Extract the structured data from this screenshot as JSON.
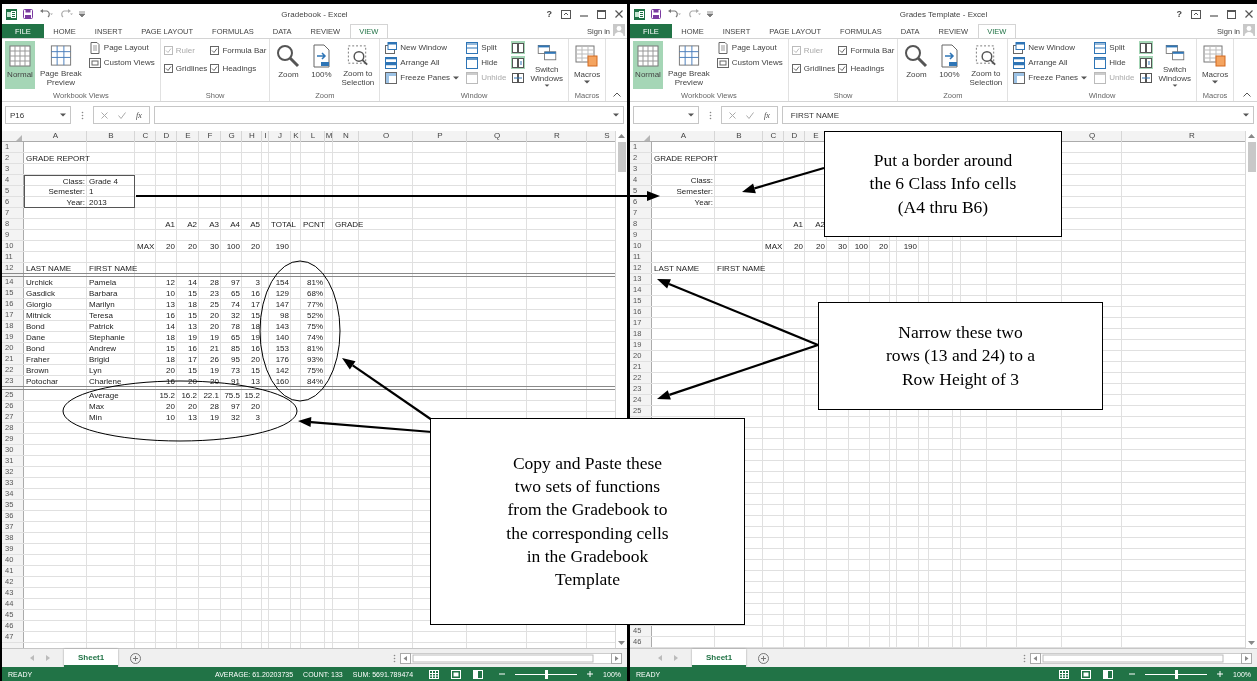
{
  "windows": [
    {
      "title": "Gradebook - Excel",
      "help": "?",
      "sign_in": "Sign in",
      "tabs": [
        {
          "label": "FILE",
          "kind": "file",
          "selected": false
        },
        {
          "label": "HOME",
          "kind": "tab",
          "selected": false
        },
        {
          "label": "INSERT",
          "kind": "tab",
          "selected": false
        },
        {
          "label": "PAGE LAYOUT",
          "kind": "tab",
          "selected": false
        },
        {
          "label": "FORMULAS",
          "kind": "tab",
          "selected": false
        },
        {
          "label": "DATA",
          "kind": "tab",
          "selected": false
        },
        {
          "label": "REVIEW",
          "kind": "tab",
          "selected": false
        },
        {
          "label": "VIEW",
          "kind": "tab",
          "selected": true
        }
      ],
      "ribbon": [
        {
          "label": "Workbook Views",
          "columns": [
            [
              {
                "kind": "large",
                "label": "Normal",
                "selected": true,
                "dropdown": false
              }
            ],
            [
              {
                "kind": "large",
                "label": "Page Break\nPreview",
                "selected": false,
                "dropdown": false
              }
            ],
            [
              {
                "kind": "small",
                "label": "Page Layout",
                "disabled": false,
                "dropdown": false
              },
              {
                "kind": "small",
                "label": "Custom Views",
                "disabled": false,
                "dropdown": false
              }
            ]
          ]
        },
        {
          "label": "Show",
          "columns": [
            [
              {
                "kind": "check",
                "label": "Ruler",
                "checked": true,
                "disabled": true
              },
              {
                "kind": "check",
                "label": "Gridlines",
                "checked": true,
                "disabled": false
              }
            ],
            [
              {
                "kind": "check",
                "label": "Formula Bar",
                "checked": true,
                "disabled": false
              },
              {
                "kind": "check",
                "label": "Headings",
                "checked": true,
                "disabled": false
              }
            ]
          ]
        },
        {
          "label": "Zoom",
          "columns": [
            [
              {
                "kind": "large",
                "label": "Zoom",
                "selected": false,
                "dropdown": false
              }
            ],
            [
              {
                "kind": "large",
                "label": "100%",
                "selected": false,
                "dropdown": false
              }
            ],
            [
              {
                "kind": "large",
                "label": "Zoom to\nSelection",
                "selected": false,
                "dropdown": false
              }
            ]
          ]
        },
        {
          "label": "Window",
          "columns": [
            [
              {
                "kind": "small",
                "label": "New Window",
                "disabled": false,
                "dropdown": false
              },
              {
                "kind": "small",
                "label": "Arrange All",
                "disabled": false,
                "dropdown": false
              },
              {
                "kind": "small",
                "label": "Freeze Panes",
                "disabled": false,
                "dropdown": true
              }
            ],
            [
              {
                "kind": "small",
                "label": "Split",
                "disabled": false,
                "dropdown": false
              },
              {
                "kind": "small",
                "label": "Hide",
                "disabled": false,
                "dropdown": false
              },
              {
                "kind": "small",
                "label": "Unhide",
                "disabled": true,
                "dropdown": false
              }
            ],
            [
              {
                "kind": "icon",
                "selected": true
              },
              {
                "kind": "icon",
                "selected": true
              },
              {
                "kind": "icon",
                "selected": false
              }
            ],
            [
              {
                "kind": "large",
                "label": "Switch\nWindows",
                "selected": false,
                "dropdown": true
              }
            ]
          ]
        },
        {
          "label": "Macros",
          "columns": [
            [
              {
                "kind": "large",
                "label": "Macros",
                "selected": false,
                "dropdown": true
              }
            ]
          ]
        }
      ],
      "name_box": "P16",
      "function_label": "fx",
      "columns": [
        {
          "label": "A"
        },
        {
          "label": "B"
        },
        {
          "label": "C"
        },
        {
          "label": "D"
        },
        {
          "label": "E"
        },
        {
          "label": "F"
        },
        {
          "label": "G"
        },
        {
          "label": "H"
        },
        {
          "label": "I"
        },
        {
          "label": "J"
        },
        {
          "label": "K"
        },
        {
          "label": "L"
        },
        {
          "label": "M"
        },
        {
          "label": "N"
        },
        {
          "label": "O"
        },
        {
          "label": "P"
        },
        {
          "label": "Q"
        },
        {
          "label": "R"
        },
        {
          "label": "S"
        }
      ],
      "rows": [
        {
          "kind": "blank",
          "num": "1"
        },
        {
          "kind": "title",
          "num": "2",
          "cells": [
            "GRADE REPORT"
          ]
        },
        {
          "kind": "blank",
          "num": "3"
        },
        {
          "kind": "info",
          "num": "4",
          "bordered": true,
          "cells": [
            "Class:",
            "Grade 4"
          ]
        },
        {
          "kind": "info",
          "num": "5",
          "bordered": true,
          "cells": [
            "Semester:",
            "1"
          ]
        },
        {
          "kind": "info",
          "num": "6",
          "bordered": true,
          "cells": [
            "Year:",
            "2013"
          ]
        },
        {
          "kind": "blank",
          "num": "7"
        },
        {
          "kind": "head",
          "num": "8",
          "cells": [
            null,
            null,
            null,
            "A1",
            "A2",
            "A3",
            "A4",
            "A5",
            null,
            "TOTAL",
            null,
            "PCNT",
            null,
            "GRADE"
          ]
        },
        {
          "kind": "blank",
          "num": "9"
        },
        {
          "kind": "data",
          "num": "10",
          "cells": [
            null,
            null,
            "MAX",
            "20",
            "20",
            "30",
            "100",
            "20",
            null,
            "190"
          ]
        },
        {
          "kind": "blank",
          "num": "11"
        },
        {
          "kind": "head",
          "num": "12",
          "cells": [
            "LAST NAME",
            "FIRST NAME"
          ]
        },
        {
          "kind": "thin"
        },
        {
          "kind": "data",
          "num": "14",
          "cells": [
            "Urchick",
            "Pamela",
            null,
            "12",
            "14",
            "28",
            "97",
            "3",
            null,
            "154",
            null,
            "81%"
          ]
        },
        {
          "kind": "data",
          "num": "15",
          "cells": [
            "Gasdick",
            "Barbara",
            null,
            "10",
            "15",
            "23",
            "65",
            "16",
            null,
            "129",
            null,
            "68%"
          ]
        },
        {
          "kind": "data",
          "num": "16",
          "cells": [
            "Giorgio",
            "Marilyn",
            null,
            "13",
            "18",
            "25",
            "74",
            "17",
            null,
            "147",
            null,
            "77%"
          ]
        },
        {
          "kind": "data",
          "num": "17",
          "cells": [
            "Mitnick",
            "Teresa",
            null,
            "16",
            "15",
            "20",
            "32",
            "15",
            null,
            "98",
            null,
            "52%"
          ]
        },
        {
          "kind": "data",
          "num": "18",
          "cells": [
            "Bond",
            "Patrick",
            null,
            "14",
            "13",
            "20",
            "78",
            "18",
            null,
            "143",
            null,
            "75%"
          ]
        },
        {
          "kind": "data",
          "num": "19",
          "cells": [
            "Dane",
            "Stephanie",
            null,
            "18",
            "19",
            "19",
            "65",
            "19",
            null,
            "140",
            null,
            "74%"
          ]
        },
        {
          "kind": "data",
          "num": "20",
          "cells": [
            "Bond",
            "Andrew",
            null,
            "15",
            "16",
            "21",
            "85",
            "16",
            null,
            "153",
            null,
            "81%"
          ]
        },
        {
          "kind": "data",
          "num": "21",
          "cells": [
            "Fraher",
            "Brigid",
            null,
            "18",
            "17",
            "26",
            "95",
            "20",
            null,
            "176",
            null,
            "93%"
          ]
        },
        {
          "kind": "data",
          "num": "22",
          "cells": [
            "Brown",
            "Lyn",
            null,
            "20",
            "15",
            "19",
            "73",
            "15",
            null,
            "142",
            null,
            "75%"
          ]
        },
        {
          "kind": "data",
          "num": "23",
          "cells": [
            "Potochar",
            "Charlene",
            null,
            "16",
            "20",
            "20",
            "91",
            "13",
            null,
            "160",
            null,
            "84%"
          ]
        },
        {
          "kind": "thin"
        },
        {
          "kind": "data",
          "num": "25",
          "cells": [
            null,
            "Average",
            null,
            "15.2",
            "16.2",
            "22.1",
            "75.5",
            "15.2"
          ]
        },
        {
          "kind": "data",
          "num": "26",
          "cells": [
            null,
            "Max",
            null,
            "20",
            "20",
            "28",
            "97",
            "20"
          ]
        },
        {
          "kind": "data",
          "num": "27",
          "cells": [
            null,
            "Min",
            null,
            "10",
            "13",
            "19",
            "32",
            "3"
          ]
        },
        {
          "kind": "blank",
          "num": "28"
        },
        {
          "kind": "blank",
          "num": "29"
        },
        {
          "kind": "blank",
          "num": "30"
        },
        {
          "kind": "blank",
          "num": "31"
        },
        {
          "kind": "blank",
          "num": "32"
        },
        {
          "kind": "blank",
          "num": "33"
        },
        {
          "kind": "blank",
          "num": "34"
        },
        {
          "kind": "blank",
          "num": "35"
        },
        {
          "kind": "blank",
          "num": "36"
        },
        {
          "kind": "blank",
          "num": "37"
        },
        {
          "kind": "blank",
          "num": "38"
        },
        {
          "kind": "blank",
          "num": "39"
        },
        {
          "kind": "blank",
          "num": "40"
        },
        {
          "kind": "blank",
          "num": "41"
        },
        {
          "kind": "blank",
          "num": "42"
        },
        {
          "kind": "blank",
          "num": "43"
        },
        {
          "kind": "blank",
          "num": "44"
        },
        {
          "kind": "blank",
          "num": "45"
        },
        {
          "kind": "blank",
          "num": "46"
        },
        {
          "kind": "blank",
          "num": "47"
        },
        {
          "kind": "blank"
        }
      ],
      "sheets": [
        {
          "label": "Sheet1",
          "selected": true
        }
      ],
      "status": {
        "mode": "READY",
        "summary": [
          "AVERAGE: 61.20203735",
          "COUNT: 133",
          "SUM: 5691.789474"
        ],
        "zoom_slider": {
          "level": 0.5
        },
        "zoom": "100%"
      }
    },
    {
      "title": "Grades Template - Excel",
      "help": "?",
      "sign_in": "Sign in",
      "tabs": [
        {
          "label": "FILE",
          "kind": "file",
          "selected": false
        },
        {
          "label": "HOME",
          "kind": "tab",
          "selected": false
        },
        {
          "label": "INSERT",
          "kind": "tab",
          "selected": false
        },
        {
          "label": "PAGE LAYOUT",
          "kind": "tab",
          "selected": false
        },
        {
          "label": "FORMULAS",
          "kind": "tab",
          "selected": false
        },
        {
          "label": "DATA",
          "kind": "tab",
          "selected": false
        },
        {
          "label": "REVIEW",
          "kind": "tab",
          "selected": false
        },
        {
          "label": "VIEW",
          "kind": "tab",
          "selected": true
        }
      ],
      "ribbon": [
        {
          "label": "Workbook Views",
          "columns": [
            [
              {
                "kind": "large",
                "label": "Normal",
                "selected": true,
                "dropdown": false
              }
            ],
            [
              {
                "kind": "large",
                "label": "Page Break\nPreview",
                "selected": false,
                "dropdown": false
              }
            ],
            [
              {
                "kind": "small",
                "label": "Page Layout",
                "disabled": false,
                "dropdown": false
              },
              {
                "kind": "small",
                "label": "Custom Views",
                "disabled": false,
                "dropdown": false
              }
            ]
          ]
        },
        {
          "label": "Show",
          "columns": [
            [
              {
                "kind": "check",
                "label": "Ruler",
                "checked": true,
                "disabled": true
              },
              {
                "kind": "check",
                "label": "Gridlines",
                "checked": true,
                "disabled": false
              }
            ],
            [
              {
                "kind": "check",
                "label": "Formula Bar",
                "checked": true,
                "disabled": false
              },
              {
                "kind": "check",
                "label": "Headings",
                "checked": true,
                "disabled": false
              }
            ]
          ]
        },
        {
          "label": "Zoom",
          "columns": [
            [
              {
                "kind": "large",
                "label": "Zoom",
                "selected": false,
                "dropdown": false
              }
            ],
            [
              {
                "kind": "large",
                "label": "100%",
                "selected": false,
                "dropdown": false
              }
            ],
            [
              {
                "kind": "large",
                "label": "Zoom to\nSelection",
                "selected": false,
                "dropdown": false
              }
            ]
          ]
        },
        {
          "label": "Window",
          "columns": [
            [
              {
                "kind": "small",
                "label": "New Window",
                "disabled": false,
                "dropdown": false
              },
              {
                "kind": "small",
                "label": "Arrange All",
                "disabled": false,
                "dropdown": false
              },
              {
                "kind": "small",
                "label": "Freeze Panes",
                "disabled": false,
                "dropdown": true
              }
            ],
            [
              {
                "kind": "small",
                "label": "Split",
                "disabled": false,
                "dropdown": false
              },
              {
                "kind": "small",
                "label": "Hide",
                "disabled": false,
                "dropdown": false
              },
              {
                "kind": "small",
                "label": "Unhide",
                "disabled": true,
                "dropdown": false
              }
            ],
            [
              {
                "kind": "icon",
                "selected": true
              },
              {
                "kind": "icon",
                "selected": true
              },
              {
                "kind": "icon",
                "selected": false
              }
            ],
            [
              {
                "kind": "large",
                "label": "Switch\nWindows",
                "selected": false,
                "dropdown": true
              }
            ]
          ]
        },
        {
          "label": "Macros",
          "columns": [
            [
              {
                "kind": "large",
                "label": "Macros",
                "selected": false,
                "dropdown": true
              }
            ]
          ]
        }
      ],
      "function_label": "fx",
      "formula": "FIRST NAME",
      "columns": [
        {
          "label": "A"
        },
        {
          "label": "B"
        },
        {
          "label": "C"
        },
        {
          "label": "D"
        },
        {
          "label": "E"
        },
        {},
        {},
        {},
        {},
        {},
        {},
        {},
        {},
        {},
        {},
        {},
        {
          "label": "Q"
        },
        {
          "label": "R"
        }
      ],
      "rows": [
        {
          "kind": "blank",
          "num": "1"
        },
        {
          "kind": "title",
          "num": "2",
          "cells": [
            "GRADE REPORT"
          ]
        },
        {
          "kind": "blank",
          "num": "3"
        },
        {
          "kind": "info",
          "num": "4",
          "bordered": false,
          "cells": [
            "Class:"
          ]
        },
        {
          "kind": "info",
          "num": "5",
          "bordered": false,
          "cells": [
            "Semester:"
          ]
        },
        {
          "kind": "info",
          "num": "6",
          "bordered": false,
          "cells": [
            "Year:"
          ]
        },
        {
          "kind": "blank",
          "num": "7"
        },
        {
          "kind": "head",
          "num": "8",
          "cells": [
            null,
            null,
            null,
            "A1",
            "A2"
          ]
        },
        {
          "kind": "blank",
          "num": "9"
        },
        {
          "kind": "data",
          "num": "10",
          "cells": [
            null,
            null,
            "MAX",
            "20",
            "20",
            "30",
            "100",
            "20",
            null,
            "190"
          ]
        },
        {
          "kind": "blank",
          "num": "11"
        },
        {
          "kind": "head",
          "num": "12",
          "cells": [
            "LAST NAME",
            "FIRST NAME"
          ]
        },
        {
          "kind": "blank",
          "num": "13"
        },
        {
          "kind": "blank",
          "num": "14"
        },
        {
          "kind": "blank",
          "num": "15"
        },
        {
          "kind": "blank",
          "num": "16"
        },
        {
          "kind": "blank",
          "num": "17"
        },
        {
          "kind": "blank",
          "num": "18"
        },
        {
          "kind": "blank",
          "num": "19"
        },
        {
          "kind": "blank",
          "num": "20"
        },
        {
          "kind": "blank",
          "num": "21"
        },
        {
          "kind": "blank",
          "num": "22"
        },
        {
          "kind": "blank",
          "num": "23"
        },
        {
          "kind": "blank",
          "num": "24"
        },
        {
          "kind": "blank",
          "num": "25"
        },
        {
          "kind": "blank"
        },
        {
          "kind": "blank"
        },
        {
          "kind": "blank"
        },
        {
          "kind": "blank"
        },
        {
          "kind": "blank"
        },
        {
          "kind": "blank"
        },
        {
          "kind": "blank"
        },
        {
          "kind": "blank"
        },
        {
          "kind": "blank"
        },
        {
          "kind": "blank"
        },
        {
          "kind": "blank"
        },
        {
          "kind": "blank"
        },
        {
          "kind": "blank"
        },
        {
          "kind": "blank"
        },
        {
          "kind": "blank"
        },
        {
          "kind": "blank"
        },
        {
          "kind": "blank"
        },
        {
          "kind": "blank"
        },
        {
          "kind": "blank"
        },
        {
          "kind": "blank",
          "num": "45"
        },
        {
          "kind": "blank",
          "num": "46"
        }
      ],
      "sheets": [
        {
          "label": "Sheet1",
          "selected": true
        }
      ],
      "status": {
        "mode": "READY",
        "zoom_slider": {
          "level": 0.5
        },
        "zoom": "100%"
      }
    }
  ],
  "callouts": [
    {
      "text": "Put a border around\nthe 6 Class Info cells\n(A4 thru B6)"
    },
    {
      "text": "Narrow these two\nrows (13 and 24) to a\nRow Height of 3"
    },
    {
      "text": "Copy and Paste these\ntwo sets of functions\nfrom the Gradebook to\nthe corresponding cells\nin the Gradebook\nTemplate"
    }
  ]
}
